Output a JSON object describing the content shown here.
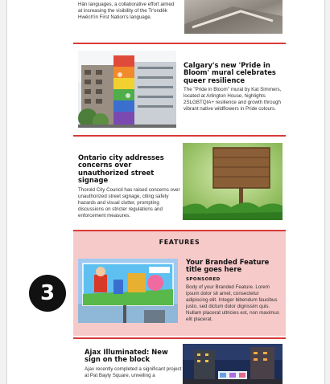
{
  "articles": [
    {
      "headline": "",
      "summary": "Hän languages, a collaborative effort aimed at increasing the visibility of the Tr'ondëk Hwëch'in First Nation's language."
    },
    {
      "headline": "Calgary's new 'Pride in Bloom' mural celebrates queer resilience",
      "summary": "The \"Pride in Bloom\" mural by Kat Simmers, located at Arlington House, highlights 2SLGBTQIA+ resilience and growth through vibrant native wildflowers in Pride colours."
    },
    {
      "headline": "Ontario city addresses concerns over unauthorized street signage",
      "summary": "Thorold City Council has raised concerns over unauthorized street signage, citing safety hazards and visual clutter, prompting discussions on stricter regulations and enforcement measures."
    }
  ],
  "features": {
    "title": "FEATURES",
    "item": {
      "headline": "Your Branded Feature title goes here",
      "tag": "SPONSORED",
      "summary": "Body of your Branded Feature. Lorem ipsum dolor sit amet, consectetur adipiscing elit. Integer bibendum faucibus justo, sed dictum dolor dignissim quis. Nullam placerat ultricies est, non maximus elit placerat."
    }
  },
  "bottom_article": {
    "headline": "Ajax Illuminated: New sign on the block",
    "summary": "Ajax recently completed a significant project at Pat Bayly Square, unveiling a"
  },
  "badge": {
    "label": "3"
  },
  "colors": {
    "divider": "#d93a3a",
    "features_bg": "#f7caca",
    "badge_bg": "#111111"
  }
}
